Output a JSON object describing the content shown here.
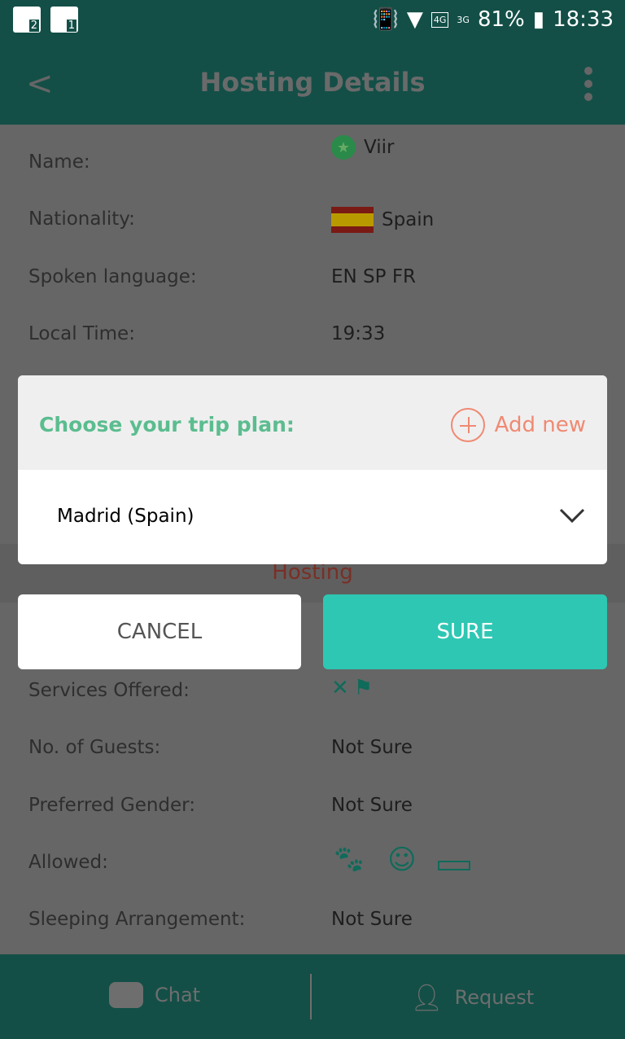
{
  "status_bar": {
    "voicemail": [
      "2",
      "1"
    ],
    "battery": "81%",
    "time": "18:33",
    "network1": "4G",
    "network2": "3G"
  },
  "app_bar": {
    "title": "Hosting Details"
  },
  "details": [
    {
      "label": "Name:",
      "value": "Viir"
    },
    {
      "label": "Nationality:",
      "value": "Spain"
    },
    {
      "label": "Spoken language:",
      "value": "EN SP FR"
    },
    {
      "label": "Local Time:",
      "value": "19:33"
    }
  ],
  "section": {
    "title": "Hosting"
  },
  "hosting": [
    {
      "label": "Services Offered:",
      "icons": [
        "utensils-icon",
        "guide-icon"
      ]
    },
    {
      "label": "No. of Guests:",
      "value": "Not Sure"
    },
    {
      "label": "Preferred Gender:",
      "value": "Not Sure"
    },
    {
      "label": "Allowed:",
      "icons": [
        "paw-icon",
        "baby-icon",
        "smoking-icon"
      ]
    },
    {
      "label": "Sleeping Arrangement:",
      "value": "Not Sure"
    }
  ],
  "dialog": {
    "title": "Choose your trip plan:",
    "add_new": "Add new",
    "selected": "Madrid (Spain)",
    "cancel": "CANCEL",
    "sure": "SURE"
  },
  "bottom_nav": {
    "chat": "Chat",
    "request": "Request"
  },
  "colors": {
    "header": "#134f47",
    "accent": "#2ec7b3",
    "dialog_title": "#5bbd8f",
    "add_new": "#ef8a72",
    "icon_teal": "#0f6b5a"
  }
}
